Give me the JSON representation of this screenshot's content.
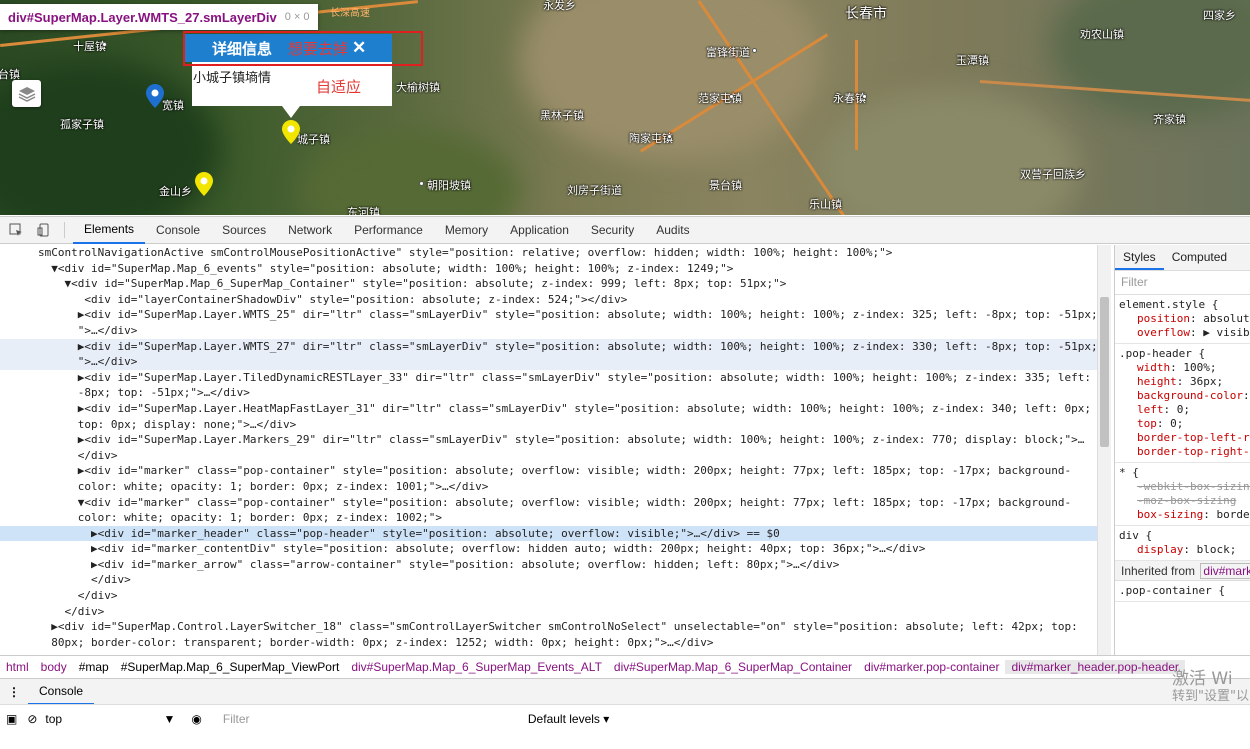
{
  "tooltip": {
    "name": "div#SuperMap.Layer.WMTS_27.smLayerDiv",
    "dims": "0 × 0"
  },
  "map": {
    "labels": [
      {
        "t": "长春市",
        "big": true
      },
      {
        "t": "十屋镇"
      },
      {
        "t": "宽镇"
      },
      {
        "t": "孤家子镇"
      },
      {
        "t": "大榆树镇"
      },
      {
        "t": "城子镇"
      },
      {
        "t": "金山乡"
      },
      {
        "t": "朝阳坡镇"
      },
      {
        "t": "东河镇"
      },
      {
        "t": "富锋街道"
      },
      {
        "t": "黑林子镇"
      },
      {
        "t": "范家屯镇"
      },
      {
        "t": "陶家屯镇"
      },
      {
        "t": "刘房子街道"
      },
      {
        "t": "景台镇"
      },
      {
        "t": "永春镇"
      },
      {
        "t": "玉潭镇"
      },
      {
        "t": "劝农山镇"
      },
      {
        "t": "四家乡"
      },
      {
        "t": "齐家镇"
      },
      {
        "t": "双营子回族乡"
      },
      {
        "t": "乐山镇"
      },
      {
        "t": "永发乡"
      },
      {
        "t": "长深高速"
      },
      {
        "t": "台镇"
      }
    ],
    "popup": {
      "title": "详细信息",
      "remove_text": "想要去掉",
      "close": "✕",
      "content": "小城子镇墒情",
      "adapt": "自适应"
    }
  },
  "devtools": {
    "tabs": [
      "Elements",
      "Console",
      "Sources",
      "Network",
      "Performance",
      "Memory",
      "Application",
      "Security",
      "Audits"
    ],
    "active_tab": "Elements",
    "dom_lines": [
      "smControlNavigationActive smControlMousePositionActive\" style=\"position: relative; overflow: hidden; width: 100%; height: 100%;\">",
      "  ▼<div id=\"SuperMap.Map_6_events\" style=\"position: absolute; width: 100%; height: 100%; z-index: 1249;\">",
      "    ▼<div id=\"SuperMap.Map_6_SuperMap_Container\" style=\"position: absolute; z-index: 999; left: 8px; top: 51px;\">",
      "       <div id=\"layerContainerShadowDiv\" style=\"position: absolute; z-index: 524;\"></div>",
      "      ▶<div id=\"SuperMap.Layer.WMTS_25\" dir=\"ltr\" class=\"smLayerDiv\" style=\"position: absolute; width: 100%; height: 100%; z-index: 325; left: -8px; top: -51px;",
      "      \">…</div>",
      "      ▶<div id=\"SuperMap.Layer.WMTS_27\" dir=\"ltr\" class=\"smLayerDiv\" style=\"position: absolute; width: 100%; height: 100%; z-index: 330; left: -8px; top: -51px;",
      "      \">…</div>",
      "      ▶<div id=\"SuperMap.Layer.TiledDynamicRESTLayer_33\" dir=\"ltr\" class=\"smLayerDiv\" style=\"position: absolute; width: 100%; height: 100%; z-index: 335; left:",
      "      -8px; top: -51px;\">…</div>",
      "      ▶<div id=\"SuperMap.Layer.HeatMapFastLayer_31\" dir=\"ltr\" class=\"smLayerDiv\" style=\"position: absolute; width: 100%; height: 100%; z-index: 340; left: 0px;",
      "      top: 0px; display: none;\">…</div>",
      "      ▶<div id=\"SuperMap.Layer.Markers_29\" dir=\"ltr\" class=\"smLayerDiv\" style=\"position: absolute; width: 100%; height: 100%; z-index: 770; display: block;\">…",
      "      </div>",
      "      ▶<div id=\"marker\" class=\"pop-container\" style=\"position: absolute; overflow: visible; width: 200px; height: 77px; left: 185px; top: -17px; background-",
      "      color: white; opacity: 1; border: 0px; z-index: 1001;\">…</div>",
      "      ▼<div id=\"marker\" class=\"pop-container\" style=\"position: absolute; overflow: visible; width: 200px; height: 77px; left: 185px; top: -17px; background-",
      "      color: white; opacity: 1; border: 0px; z-index: 1002;\">",
      "        ▶<div id=\"marker_header\" class=\"pop-header\" style=\"position: absolute; overflow: visible;\">…</div> == $0",
      "        ▶<div id=\"marker_contentDiv\" style=\"position: absolute; overflow: hidden auto; width: 200px; height: 40px; top: 36px;\">…</div>",
      "        ▶<div id=\"marker_arrow\" class=\"arrow-container\" style=\"position: absolute; overflow: hidden; left: 80px;\">…</div>",
      "        </div>",
      "      </div>",
      "    </div>",
      "  ▶<div id=\"SuperMap.Control.LayerSwitcher_18\" class=\"smControlLayerSwitcher smControlNoSelect\" unselectable=\"on\" style=\"position: absolute; left: 42px; top:",
      "  80px; border-color: transparent; border-width: 0px; z-index: 1252; width: 0px; height: 0px;\">…</div>"
    ],
    "styles": {
      "tabs": [
        "Styles",
        "Computed"
      ],
      "filter_placeholder": "Filter",
      "rules": [
        {
          "selector": "element.style {",
          "props": [
            [
              "position",
              "absolute"
            ],
            [
              "overflow",
              "▶ visible"
            ]
          ]
        },
        {
          "selector": ".pop-header {",
          "props": [
            [
              "width",
              "100%;"
            ],
            [
              "height",
              "36px;"
            ],
            [
              "background-color",
              ""
            ],
            [
              "left",
              "0;"
            ],
            [
              "top",
              "0;"
            ],
            [
              "border-top-left-ra",
              ""
            ],
            [
              "border-top-right-r",
              ""
            ]
          ]
        },
        {
          "selector": "* {",
          "props": [
            [
              "-webkit-box-sizing",
              ""
            ],
            [
              "-moz-box-sizing",
              ""
            ],
            [
              "box-sizing",
              "border"
            ]
          ]
        },
        {
          "selector": "div {",
          "props": [
            [
              "display",
              "block;"
            ]
          ]
        }
      ],
      "inherited_label": "Inherited from",
      "inherited_node": "div#mark",
      "last_selector": ".pop-container {"
    },
    "breadcrumbs": [
      "html",
      "body",
      "#map",
      "#SuperMap.Map_6_SuperMap_ViewPort",
      "div#SuperMap.Map_6_SuperMap_Events_ALT",
      "div#SuperMap.Map_6_SuperMap_Container",
      "div#marker.pop-container",
      "div#marker_header.pop-header"
    ],
    "drawer_tab": "Console",
    "context": "top",
    "console_filter": "Filter",
    "levels": "Default levels ▾"
  },
  "watermark": {
    "line1": "激活 Wi",
    "line2": "转到\"设置\"以"
  }
}
